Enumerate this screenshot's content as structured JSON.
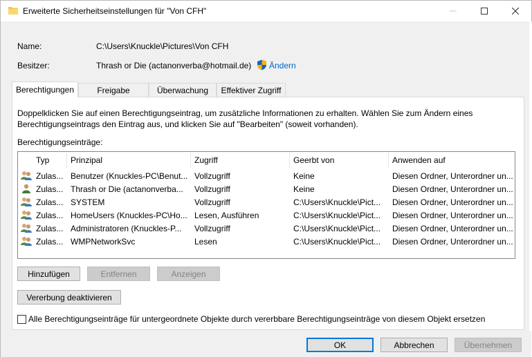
{
  "window": {
    "title": "Erweiterte Sicherheitseinstellungen für \"Von CFH\""
  },
  "info": {
    "name_label": "Name:",
    "name_value": "C:\\Users\\Knuckle\\Pictures\\Von CFH",
    "owner_label": "Besitzer:",
    "owner_value": "Thrash or Die (actanonverba@hotmail.de)",
    "change_link": "Ändern"
  },
  "tabs": [
    {
      "label": "Berechtigungen",
      "active": true
    },
    {
      "label": "Freigabe",
      "active": false
    },
    {
      "label": "Überwachung",
      "active": false
    },
    {
      "label": "Effektiver Zugriff",
      "active": false
    }
  ],
  "description_line1": "Doppelklicken Sie auf einen Berechtigungseintrag, um zusätzliche Informationen zu erhalten. Wählen Sie zum Ändern eines",
  "description_line2": "Berechtigungseintrags den Eintrag aus, und klicken Sie auf \"Bearbeiten\" (soweit vorhanden).",
  "entries_label": "Berechtigungseinträge:",
  "table": {
    "columns": [
      "Typ",
      "Prinzipal",
      "Zugriff",
      "Geerbt von",
      "Anwenden auf"
    ],
    "rows": [
      {
        "icon": "group-icon",
        "typ": "Zulas...",
        "prinzipal": "Benutzer (Knuckles-PC\\Benut...",
        "zugriff": "Vollzugriff",
        "geerbt": "Keine",
        "anwenden": "Diesen Ordner, Unterordner un..."
      },
      {
        "icon": "user-icon",
        "typ": "Zulas...",
        "prinzipal": "Thrash or Die (actanonverba...",
        "zugriff": "Vollzugriff",
        "geerbt": "Keine",
        "anwenden": "Diesen Ordner, Unterordner un..."
      },
      {
        "icon": "group-icon",
        "typ": "Zulas...",
        "prinzipal": "SYSTEM",
        "zugriff": "Vollzugriff",
        "geerbt": "C:\\Users\\Knuckle\\Pict...",
        "anwenden": "Diesen Ordner, Unterordner un..."
      },
      {
        "icon": "group-icon",
        "typ": "Zulas...",
        "prinzipal": "HomeUsers (Knuckles-PC\\Ho...",
        "zugriff": "Lesen, Ausführen",
        "geerbt": "C:\\Users\\Knuckle\\Pict...",
        "anwenden": "Diesen Ordner, Unterordner un..."
      },
      {
        "icon": "group-icon",
        "typ": "Zulas...",
        "prinzipal": "Administratoren (Knuckles-P...",
        "zugriff": "Vollzugriff",
        "geerbt": "C:\\Users\\Knuckle\\Pict...",
        "anwenden": "Diesen Ordner, Unterordner un..."
      },
      {
        "icon": "group-icon",
        "typ": "Zulas...",
        "prinzipal": "WMPNetworkSvc",
        "zugriff": "Lesen",
        "geerbt": "C:\\Users\\Knuckle\\Pict...",
        "anwenden": "Diesen Ordner, Unterordner un..."
      }
    ]
  },
  "buttons": {
    "add": "Hinzufügen",
    "remove": "Entfernen",
    "view": "Anzeigen",
    "disable_inheritance": "Vererbung deaktivieren",
    "ok": "OK",
    "cancel": "Abbrechen",
    "apply": "Übernehmen"
  },
  "replace_checkbox": {
    "label": "Alle Berechtigungseinträge für untergeordnete Objekte durch vererbbare Berechtigungseinträge von diesem Objekt ersetzen",
    "checked": false
  },
  "colors": {
    "link": "#0066cc",
    "accent": "#0078d7",
    "folder": "#f4c54a"
  }
}
